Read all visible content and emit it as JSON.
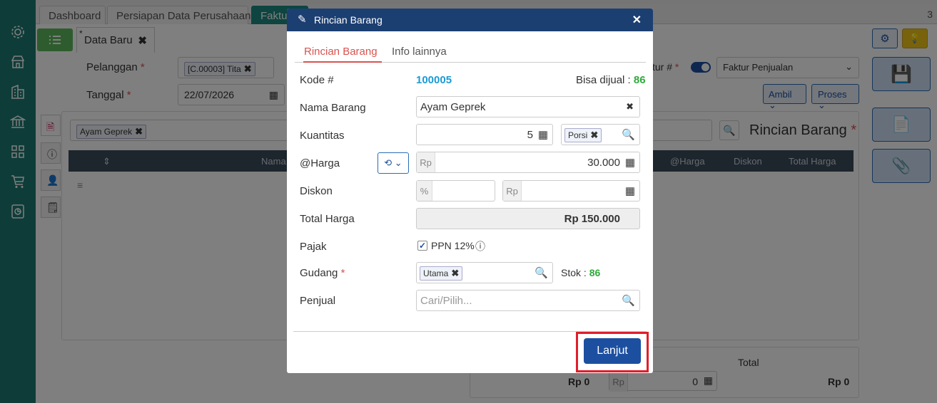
{
  "tabs": [
    {
      "label": "Dashboard"
    },
    {
      "label": "Persiapan Data Perusahaan"
    },
    {
      "label": "Faktur"
    }
  ],
  "tab_count": "3",
  "doc_tab": {
    "label": "Data Baru",
    "marker": "*"
  },
  "form": {
    "pelanggan_label": "Pelanggan",
    "pelanggan_chip": "[C.00003] Tita",
    "tanggal_label": "Tanggal",
    "tanggal_value": "22/07/2026",
    "faktur_label": "tur #",
    "faktur_type": "Faktur Penjualan",
    "ambil_label": "Ambil",
    "proses_label": "Proses"
  },
  "detail": {
    "search_chip": "Ayam Geprek",
    "title": "Rincian Barang",
    "columns": [
      "Nama",
      "@Harga",
      "Diskon",
      "Total Harga"
    ]
  },
  "footer": {
    "total_label": "Total",
    "left_amount": "Rp 0",
    "rp_prefix": "Rp",
    "mid_value": "0",
    "right_amount": "Rp 0"
  },
  "modal": {
    "title": "Rincian Barang",
    "tabs": [
      "Rincian Barang",
      "Info lainnya"
    ],
    "kode_label": "Kode #",
    "kode_value": "100005",
    "bisa_dijual_label": "Bisa dijual :",
    "bisa_dijual_value": "86",
    "nama_label": "Nama Barang",
    "nama_value": "Ayam Geprek",
    "kuantitas_label": "Kuantitas",
    "kuantitas_value": "5",
    "unit_chip": "Porsi",
    "harga_label": "@Harga",
    "harga_prefix": "Rp",
    "harga_value": "30.000",
    "diskon_label": "Diskon",
    "diskon_pct_prefix": "%",
    "diskon_rp_prefix": "Rp",
    "total_label": "Total Harga",
    "total_value": "Rp 150.000",
    "pajak_label": "Pajak",
    "ppn_label": "PPN 12%",
    "gudang_label": "Gudang",
    "gudang_chip": "Utama",
    "stok_label": "Stok :",
    "stok_value": "86",
    "penjual_label": "Penjual",
    "penjual_placeholder": "Cari/Pilih...",
    "lanjut_label": "Lanjut"
  },
  "colors": {
    "accent_green": "#2eaa3a",
    "kode_blue": "#1b9ad6",
    "required": "#d9534f",
    "primary": "#1c4fa0",
    "highlight": "#e01e2a"
  }
}
